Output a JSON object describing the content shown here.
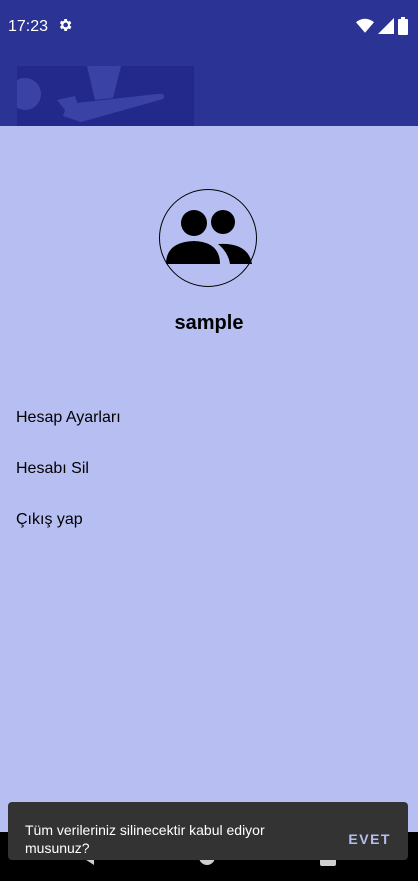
{
  "status_bar": {
    "time": "17:23",
    "left_icons": [
      "gear-icon"
    ],
    "right_icons": [
      "wifi-icon",
      "cellular-signal-icon",
      "battery-icon"
    ]
  },
  "header": {
    "banner_icon": "airplane-takeoff-icon",
    "background_color": "#2b3494"
  },
  "profile": {
    "avatar_icon": "group-icon",
    "username": "sample"
  },
  "menu": {
    "items": [
      {
        "label": "Hesap Ayarları"
      },
      {
        "label": "Hesabı Sil"
      },
      {
        "label": "Çıkış yap"
      }
    ]
  },
  "snackbar": {
    "message": "Tüm verileriniz silinecektir kabul ediyor musunuz?",
    "action": "EVET"
  },
  "navigation_bar": {
    "icons": [
      "back-icon",
      "home-icon",
      "recent-apps-icon"
    ]
  },
  "colors": {
    "page_background": "#b7bff2",
    "app_bar": "#2b3494",
    "snackbar_background": "#333333",
    "snackbar_action": "#b7bff2"
  }
}
